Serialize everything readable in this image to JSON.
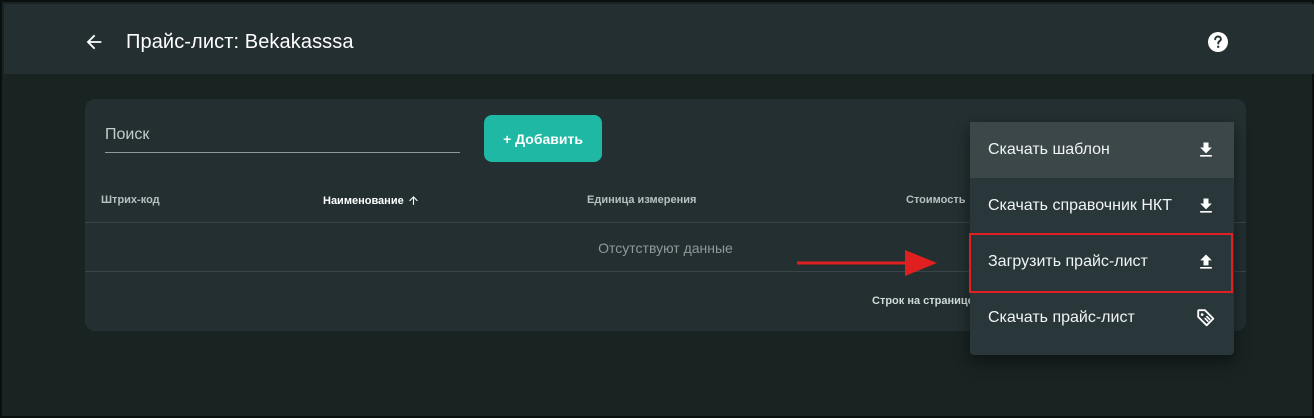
{
  "header": {
    "title": "Прайс-лист: Bekakasssa"
  },
  "search": {
    "placeholder": "Поиск"
  },
  "toolbar": {
    "add_label": "+ Добавить"
  },
  "table": {
    "columns": [
      "Штрих-код",
      "Наименование",
      "Единица измерения",
      "Стоимость"
    ],
    "sorted_column": "Наименование",
    "empty_text": "Отсутствуют данные",
    "rows_per_page_label": "Строк на странице:"
  },
  "menu": {
    "items": [
      {
        "label": "Скачать шаблон",
        "icon": "download-icon"
      },
      {
        "label": "Скачать справочник НКТ",
        "icon": "download-icon"
      },
      {
        "label": "Загрузить прайс-лист",
        "icon": "upload-icon"
      },
      {
        "label": "Скачать прайс-лист",
        "icon": "tag-icon"
      }
    ],
    "hovered_index": 0,
    "highlighted_index": 2
  },
  "colors": {
    "background": "#182322",
    "surface": "#232f31",
    "menu": "#29363a",
    "accent": "#1fb8a4",
    "highlight": "#e02020"
  }
}
